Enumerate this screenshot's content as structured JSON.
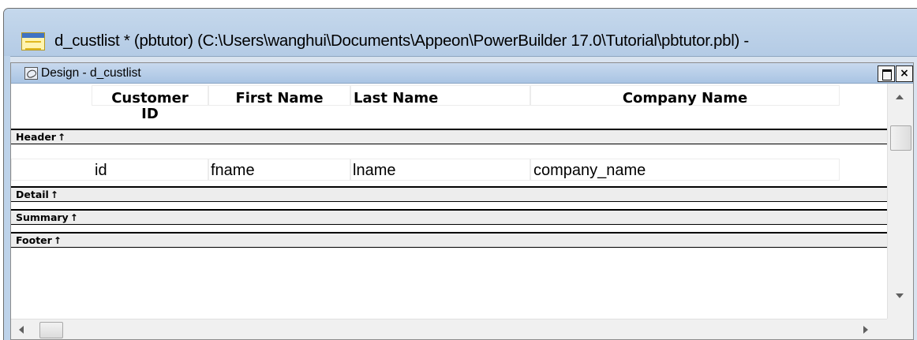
{
  "window": {
    "title": "d_custlist * (pbtutor) (C:\\Users\\wanghui\\Documents\\Appeon\\PowerBuilder 17.0\\Tutorial\\pbtutor.pbl) -",
    "icon": "datawindow-icon"
  },
  "design_view": {
    "title": "Design - d_custlist",
    "icon": "design-painter-icon",
    "restore_icon": "restore-icon",
    "close_label": "×"
  },
  "columns": {
    "headers": [
      {
        "line1": "Customer",
        "line2": "ID"
      },
      {
        "line1": "First Name",
        "line2": ""
      },
      {
        "line1": "Last Name",
        "line2": ""
      },
      {
        "line1": "Company Name",
        "line2": ""
      }
    ],
    "fields": [
      "id",
      "fname",
      "lname",
      "company_name"
    ]
  },
  "bands": {
    "header": "Header",
    "detail": "Detail",
    "summary": "Summary",
    "footer": "Footer",
    "arrow": "↑"
  },
  "scrollbars": {
    "up_icon": "arrow-up-icon",
    "down_icon": "arrow-down-icon",
    "left_icon": "arrow-left-icon",
    "right_icon": "arrow-right-icon"
  }
}
